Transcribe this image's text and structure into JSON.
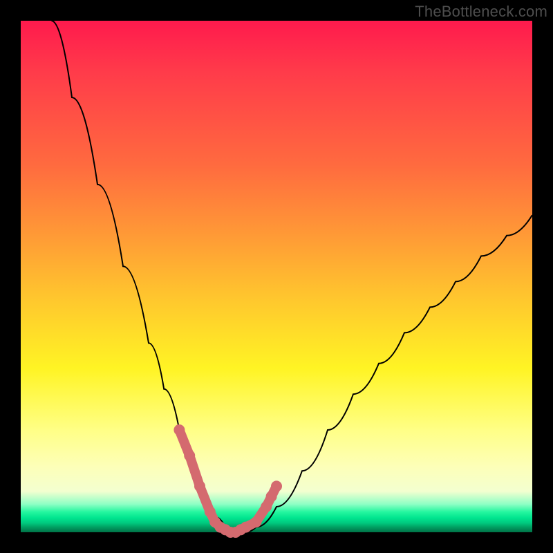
{
  "watermark": "TheBottleneck.com",
  "colors": {
    "frame": "#000000",
    "gradient_top": "#ff1a4d",
    "gradient_mid": "#fff424",
    "gradient_green": "#00e58f",
    "curve": "#000000",
    "marker": "#d46a6f"
  },
  "chart_data": {
    "type": "line",
    "title": "",
    "xlabel": "",
    "ylabel": "",
    "xlim": [
      0,
      100
    ],
    "ylim": [
      0,
      100
    ],
    "grid": false,
    "legend": false,
    "series": [
      {
        "name": "bottleneck-curve",
        "x": [
          6,
          10,
          15,
          20,
          25,
          28,
          31,
          34,
          36,
          38,
          40,
          42,
          44,
          46,
          50,
          55,
          60,
          65,
          70,
          75,
          80,
          85,
          90,
          95,
          100
        ],
        "y": [
          100,
          85,
          68,
          52,
          37,
          28,
          20,
          12,
          7,
          3,
          1,
          0,
          0,
          1,
          5,
          12,
          20,
          27,
          33,
          39,
          44,
          49,
          54,
          58,
          62
        ]
      }
    ],
    "annotations": [
      {
        "name": "highlight-markers",
        "type": "scatter",
        "color": "#d46a6f",
        "x": [
          31,
          33,
          35,
          37,
          38,
          39,
          40,
          41,
          42,
          43,
          44,
          46,
          48,
          49,
          50
        ],
        "y": [
          20,
          15,
          9,
          4,
          2,
          1,
          0.5,
          0,
          0,
          0.5,
          1,
          2,
          5,
          7,
          9
        ]
      }
    ]
  }
}
